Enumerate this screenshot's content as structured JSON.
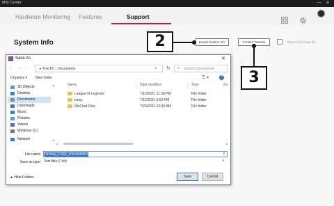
{
  "app": {
    "title": "MSI Center",
    "minimize": "—",
    "close": "✕"
  },
  "nav": {
    "tabs": [
      {
        "label": "Hardware Monitoring"
      },
      {
        "label": "Features"
      },
      {
        "label": "Support"
      }
    ],
    "active_tab": "Support",
    "accent_color": "#c4203a"
  },
  "header_icons": [
    "grid-icon",
    "gear-icon",
    "avatar"
  ],
  "page": {
    "title": "System Info",
    "export_button": "Export System Info",
    "contact_button": "Contact Transfer",
    "checkbox_label": "Export minidump file"
  },
  "callouts": {
    "step2": "2",
    "step3": "3"
  },
  "dialog": {
    "title": "Save As",
    "close": "✕",
    "nav_arrows": "← → ↑",
    "address": "▸ This PC › Documents",
    "address_dropdown": "∨",
    "refresh": "↻",
    "search_placeholder": "Search Documents",
    "organize": "Organize ▾",
    "new_folder": "New folder",
    "view_icon": "☰ ▾",
    "help": "?",
    "nav_items": [
      {
        "label": "3D Objects",
        "icon": "cube-icon",
        "color": "#4a9bd8"
      },
      {
        "label": "Desktop",
        "icon": "desktop-icon",
        "color": "#3a7bd5"
      },
      {
        "label": "Documents",
        "icon": "documents-icon",
        "color": "#8a8a8a"
      },
      {
        "label": "Downloads",
        "icon": "download-icon",
        "color": "#3a7bd5"
      },
      {
        "label": "Music",
        "icon": "music-icon",
        "color": "#3a7bd5"
      },
      {
        "label": "Pictures",
        "icon": "pictures-icon",
        "color": "#5aa0d0"
      },
      {
        "label": "Videos",
        "icon": "videos-icon",
        "color": "#5a6ad0"
      },
      {
        "label": "Windows (C:)",
        "icon": "drive-icon",
        "color": "#777777"
      },
      {
        "label": "Network",
        "icon": "network-icon",
        "color": "#3a7bd5"
      }
    ],
    "selected_nav": "Documents",
    "columns": {
      "name": "Name",
      "date": "Date modified",
      "type": "Type",
      "size": "Siz"
    },
    "files": [
      {
        "name": "League of Legends",
        "date": "7/12/2021 11:39 PM",
        "type": "File folder"
      },
      {
        "name": "temp",
        "date": "7/12/2021 9:53 PM",
        "type": "File folder"
      },
      {
        "name": "WeChat Files",
        "date": "7/20/2021 12:06 AM",
        "type": "File folder"
      }
    ],
    "file_name_label": "File name:",
    "file_name_value": "DxDiag_Folder_1115AM20210720",
    "save_type_label": "Save as type:",
    "save_type_value": "Text files (*.txt)",
    "hide_folders": "▲ Hide Folders",
    "save_button": "Save",
    "cancel_button": "Cancel"
  }
}
